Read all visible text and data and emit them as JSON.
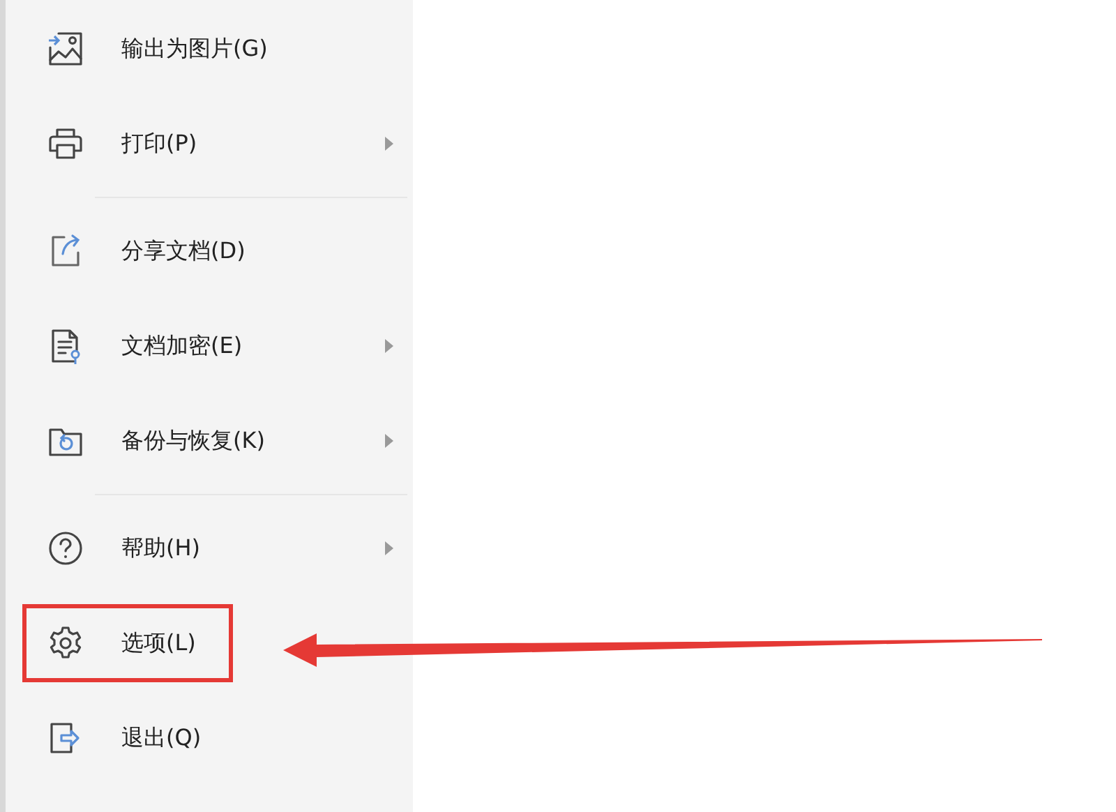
{
  "menu": {
    "items": [
      {
        "label": "输出为图片(G)",
        "has_submenu": false,
        "divider_after": false,
        "highlighted": false
      },
      {
        "label": "打印(P)",
        "has_submenu": true,
        "divider_after": true,
        "highlighted": false
      },
      {
        "label": "分享文档(D)",
        "has_submenu": false,
        "divider_after": false,
        "highlighted": false
      },
      {
        "label": "文档加密(E)",
        "has_submenu": true,
        "divider_after": false,
        "highlighted": false
      },
      {
        "label": "备份与恢复(K)",
        "has_submenu": true,
        "divider_after": true,
        "highlighted": false
      },
      {
        "label": "帮助(H)",
        "has_submenu": true,
        "divider_after": false,
        "highlighted": false
      },
      {
        "label": "选项(L)",
        "has_submenu": false,
        "divider_after": false,
        "highlighted": true
      },
      {
        "label": "退出(Q)",
        "has_submenu": false,
        "divider_after": false,
        "highlighted": false
      }
    ]
  }
}
